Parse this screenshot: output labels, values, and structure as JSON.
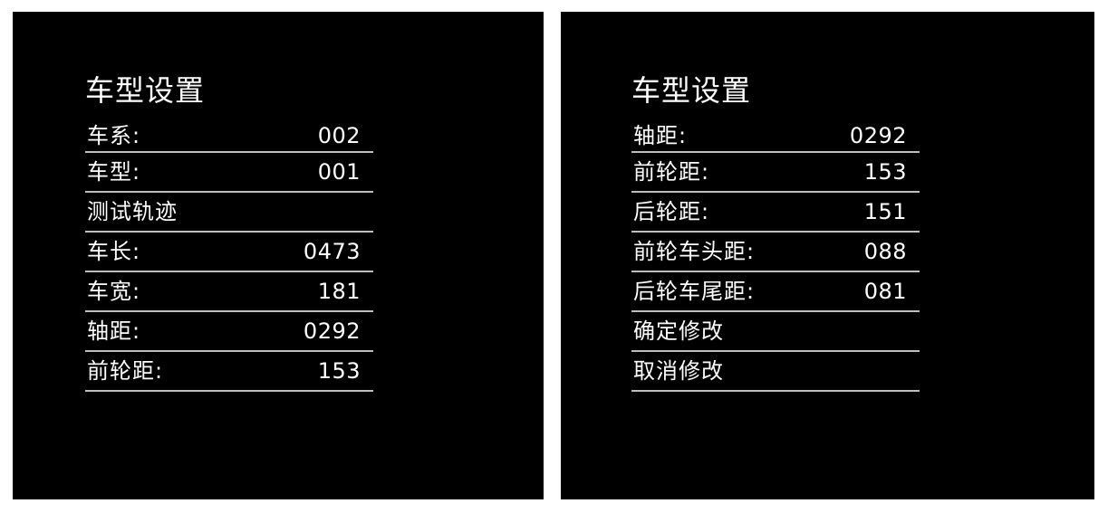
{
  "screens": [
    {
      "title": "车型设置",
      "rows": [
        {
          "label": "车系:",
          "value": "002"
        },
        {
          "label": "车型:",
          "value": "001"
        },
        {
          "label": "测试轨迹",
          "value": ""
        },
        {
          "label": "车长:",
          "value": "0473"
        },
        {
          "label": "车宽:",
          "value": "181"
        },
        {
          "label": "轴距:",
          "value": "0292"
        },
        {
          "label": "前轮距:",
          "value": "153"
        }
      ]
    },
    {
      "title": "车型设置",
      "rows": [
        {
          "label": "轴距:",
          "value": "0292"
        },
        {
          "label": "前轮距:",
          "value": "153"
        },
        {
          "label": "后轮距:",
          "value": "151"
        },
        {
          "label": "前轮车头距:",
          "value": "088"
        },
        {
          "label": "后轮车尾距:",
          "value": "081"
        },
        {
          "label": "确定修改",
          "value": ""
        },
        {
          "label": "取消修改",
          "value": ""
        }
      ]
    }
  ]
}
